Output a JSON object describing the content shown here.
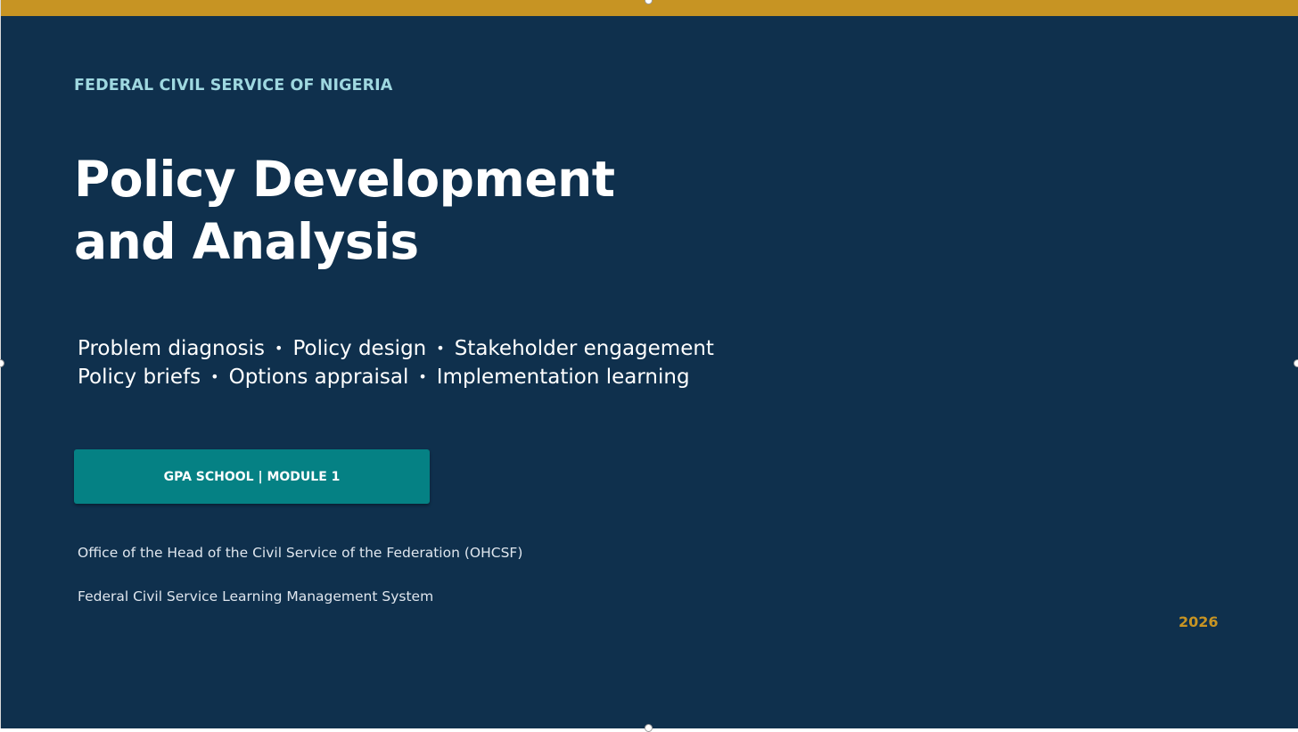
{
  "colors": {
    "background": "#0f304d",
    "accent_gold": "#c79423",
    "accent_teal": "#058184",
    "org_text": "#9fd8e0"
  },
  "slide": {
    "organization": "FEDERAL CIVIL SERVICE OF NIGERIA",
    "title_line1": "Policy Development",
    "title_line2": "and Analysis",
    "topics_row1": [
      "Problem diagnosis",
      "Policy design",
      "Stakeholder engagement"
    ],
    "topics_row2": [
      "Policy briefs",
      "Options appraisal",
      "Implementation learning"
    ],
    "separator": "•",
    "module_badge": "GPA SCHOOL  |  MODULE 1",
    "office": "Office of the Head of the Civil Service of the Federation (OHCSF)",
    "lms": "Federal Civil Service Learning Management System",
    "year": "2026"
  }
}
